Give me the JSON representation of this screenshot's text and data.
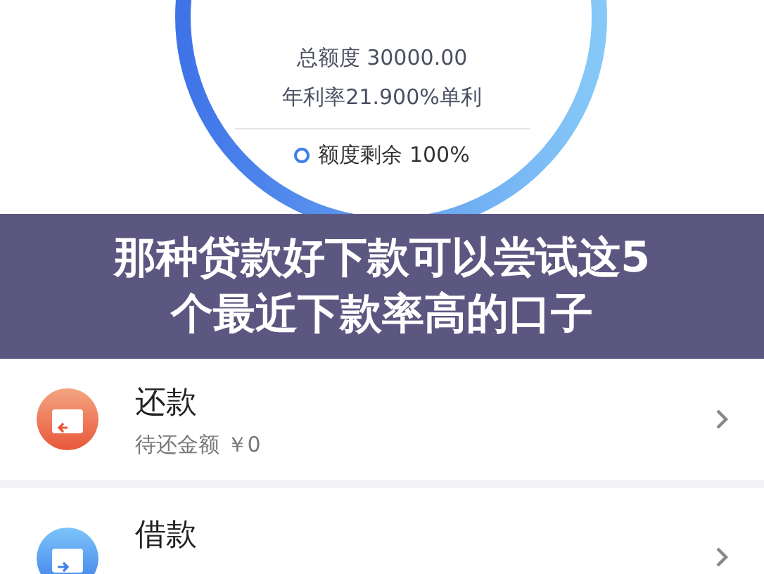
{
  "credit": {
    "total": "总额度 30000.00",
    "rate": "年利率21.900%单利",
    "remaining": "额度剩余 100%"
  },
  "headline": "那种贷款好下款可以尝试这5个最近下款率高的口子",
  "rows": [
    {
      "kind": "repay",
      "title": "还款",
      "subtitle": "待还金额 ￥0"
    },
    {
      "kind": "borrow",
      "title": "借款"
    }
  ]
}
